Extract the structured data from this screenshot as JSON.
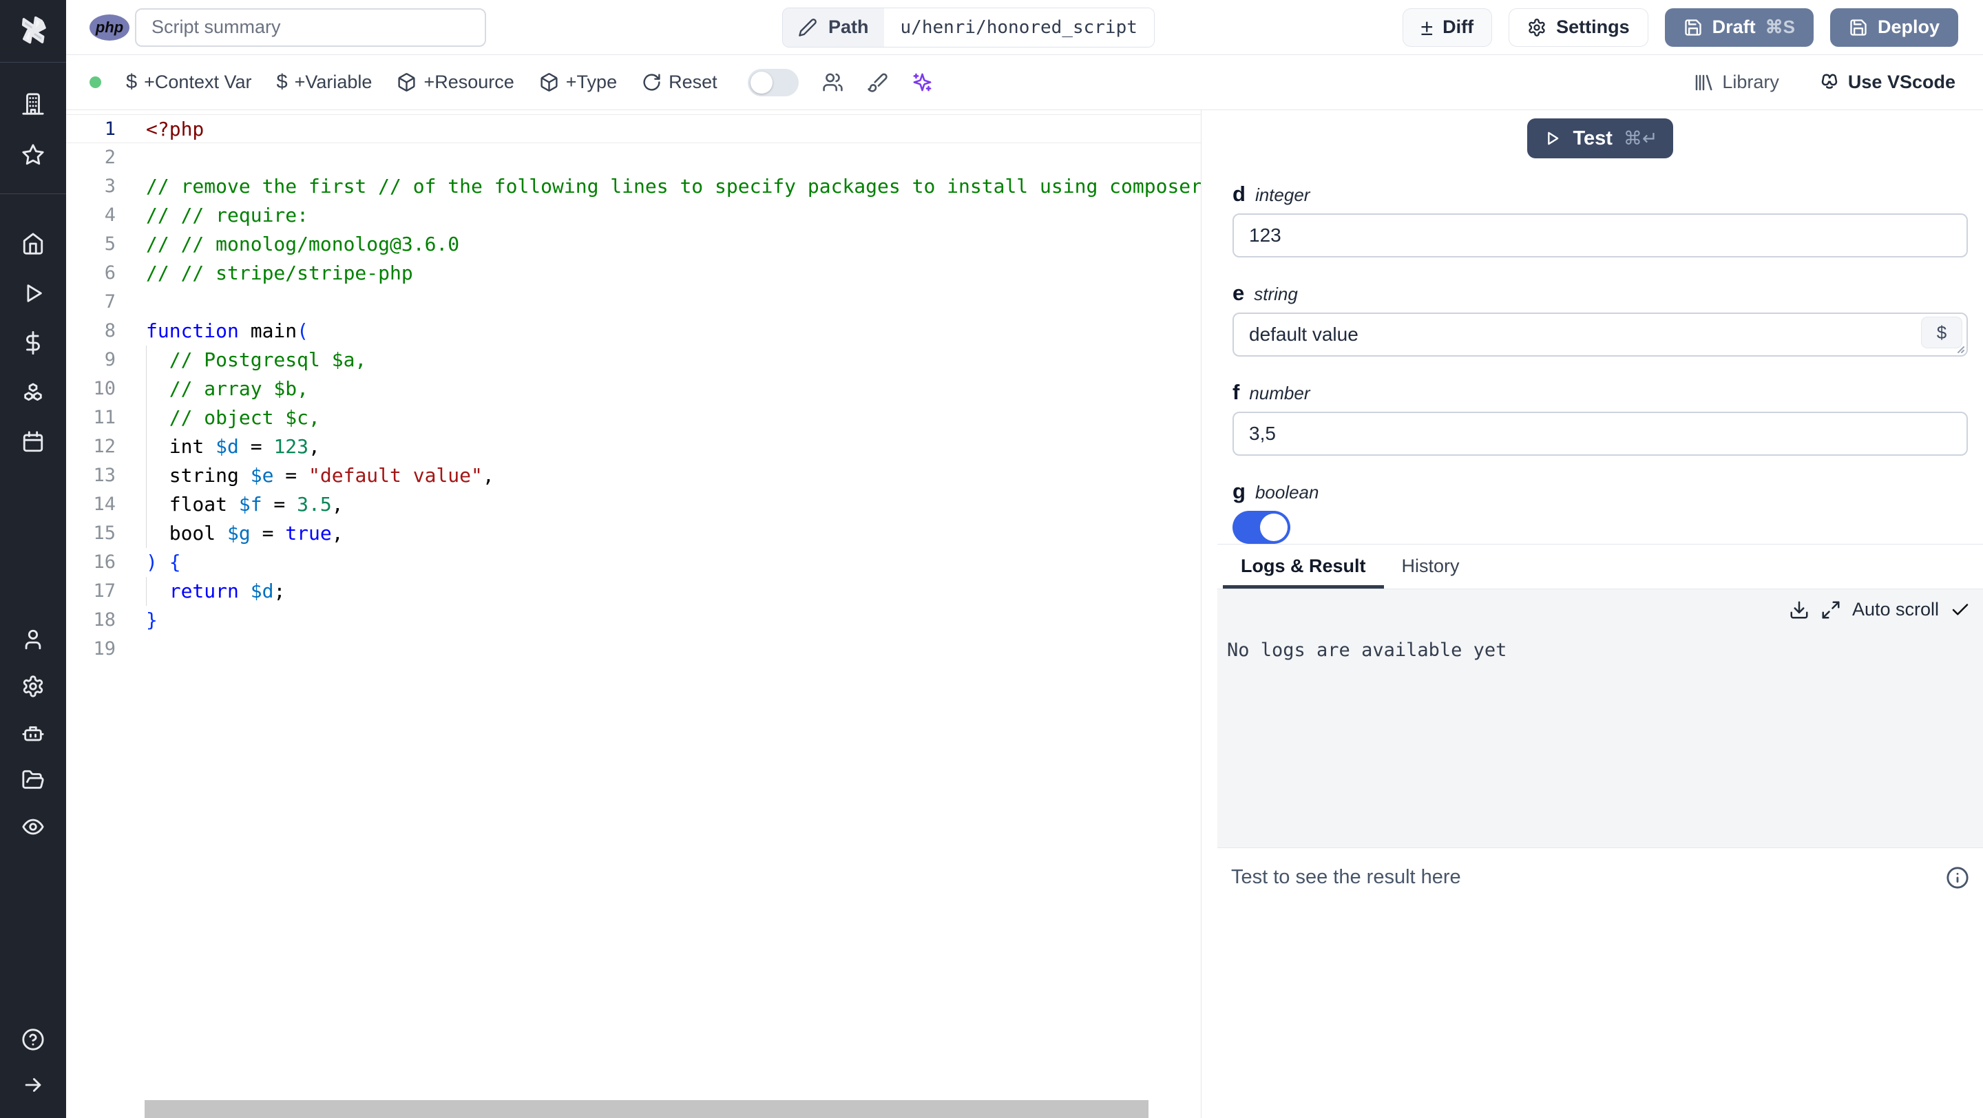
{
  "topbar": {
    "language_badge": "php",
    "summary_placeholder": "Script summary",
    "path_label": "Path",
    "path_value": "u/henri/honored_script",
    "diff_label": "Diff",
    "settings_label": "Settings",
    "draft_label": "Draft",
    "draft_shortcut": "⌘S",
    "deploy_label": "Deploy"
  },
  "toolbar": {
    "context_var_label": "+Context Var",
    "variable_label": "+Variable",
    "resource_label": "+Resource",
    "type_label": "+Type",
    "reset_label": "Reset",
    "library_label": "Library",
    "vscode_label": "Use VScode",
    "status_color": "#62c981",
    "ai_icon_color": "#7c3aed"
  },
  "editor": {
    "language": "php",
    "lines": [
      {
        "n": 1,
        "active": true,
        "segs": [
          {
            "t": "<?php",
            "c": "meta"
          }
        ]
      },
      {
        "n": 2,
        "segs": []
      },
      {
        "n": 3,
        "segs": [
          {
            "t": "// remove the first // of the following lines to specify packages to install using composer:",
            "c": "com"
          }
        ]
      },
      {
        "n": 4,
        "segs": [
          {
            "t": "// // require:",
            "c": "com"
          }
        ]
      },
      {
        "n": 5,
        "segs": [
          {
            "t": "// // monolog/monolog@3.6.0",
            "c": "com"
          }
        ]
      },
      {
        "n": 6,
        "segs": [
          {
            "t": "// // stripe/stripe-php",
            "c": "com"
          }
        ]
      },
      {
        "n": 7,
        "segs": []
      },
      {
        "n": 8,
        "segs": [
          {
            "t": "function",
            "c": "kw"
          },
          {
            "t": " main",
            "c": "plain"
          },
          {
            "t": "(",
            "c": "br"
          }
        ]
      },
      {
        "n": 9,
        "guide": true,
        "segs": [
          {
            "t": "  // Postgresql $a,",
            "c": "com"
          }
        ]
      },
      {
        "n": 10,
        "guide": true,
        "segs": [
          {
            "t": "  // array $b,",
            "c": "com"
          }
        ]
      },
      {
        "n": 11,
        "guide": true,
        "segs": [
          {
            "t": "  // object $c,",
            "c": "com"
          }
        ]
      },
      {
        "n": 12,
        "guide": true,
        "segs": [
          {
            "t": "  int ",
            "c": "plain"
          },
          {
            "t": "$d",
            "c": "var"
          },
          {
            "t": " = ",
            "c": "plain"
          },
          {
            "t": "123",
            "c": "num"
          },
          {
            "t": ",",
            "c": "plain"
          }
        ]
      },
      {
        "n": 13,
        "guide": true,
        "segs": [
          {
            "t": "  string ",
            "c": "plain"
          },
          {
            "t": "$e",
            "c": "var"
          },
          {
            "t": " = ",
            "c": "plain"
          },
          {
            "t": "\"default value\"",
            "c": "str"
          },
          {
            "t": ",",
            "c": "plain"
          }
        ]
      },
      {
        "n": 14,
        "guide": true,
        "segs": [
          {
            "t": "  float ",
            "c": "plain"
          },
          {
            "t": "$f",
            "c": "var"
          },
          {
            "t": " = ",
            "c": "plain"
          },
          {
            "t": "3.5",
            "c": "num"
          },
          {
            "t": ",",
            "c": "plain"
          }
        ]
      },
      {
        "n": 15,
        "guide": true,
        "segs": [
          {
            "t": "  bool ",
            "c": "plain"
          },
          {
            "t": "$g",
            "c": "var"
          },
          {
            "t": " = ",
            "c": "plain"
          },
          {
            "t": "true",
            "c": "kw"
          },
          {
            "t": ",",
            "c": "plain"
          }
        ]
      },
      {
        "n": 16,
        "segs": [
          {
            "t": ") {",
            "c": "br"
          }
        ]
      },
      {
        "n": 17,
        "guide": true,
        "segs": [
          {
            "t": "  ",
            "c": "plain"
          },
          {
            "t": "return",
            "c": "kw"
          },
          {
            "t": " ",
            "c": "plain"
          },
          {
            "t": "$d",
            "c": "var"
          },
          {
            "t": ";",
            "c": "plain"
          }
        ]
      },
      {
        "n": 18,
        "segs": [
          {
            "t": "}",
            "c": "br"
          }
        ]
      },
      {
        "n": 19,
        "segs": []
      }
    ]
  },
  "runner": {
    "test_label": "Test",
    "test_shortcut": "⌘↵",
    "fields": [
      {
        "name": "d",
        "type": "integer",
        "value": "123"
      },
      {
        "name": "e",
        "type": "string",
        "value": "default value",
        "var_picker_label": "$"
      },
      {
        "name": "f",
        "type": "number",
        "value": "3,5"
      },
      {
        "name": "g",
        "type": "boolean",
        "value": true
      }
    ],
    "tabs": [
      {
        "label": "Logs & Result"
      },
      {
        "label": "History"
      }
    ],
    "active_tab": "Logs & Result",
    "autoscroll_label": "Auto scroll",
    "logs_empty_text": "No logs are available yet",
    "result_placeholder": "Test to see the result here"
  },
  "colors": {
    "sidebar_bg": "#20242d",
    "primary_button_bg": "#687a9b",
    "test_button_bg": "#3d4a66",
    "toggle_on": "#3662e8",
    "logs_bg": "#f4f5f7"
  }
}
